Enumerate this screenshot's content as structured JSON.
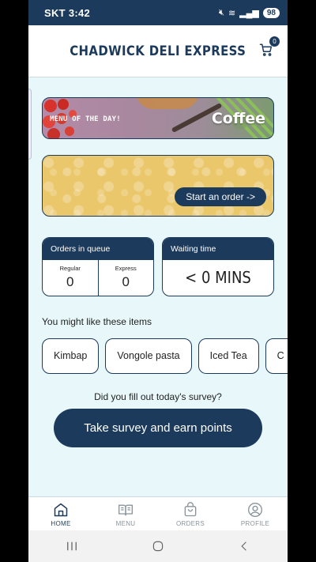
{
  "status_bar": {
    "carrier": "SKT",
    "time": "3:42",
    "battery": "98"
  },
  "header": {
    "title": "CHADWICK DELI EXPRESS",
    "cart_count": "0"
  },
  "banner_menu": {
    "label": "MENU OF THE DAY!",
    "item": "Coffee"
  },
  "banner_order": {
    "button_label": "Start an order ->"
  },
  "queue_card": {
    "title": "Orders in queue",
    "regular_label": "Regular",
    "regular_value": "0",
    "express_label": "Express",
    "express_value": "0"
  },
  "wait_card": {
    "title": "Waiting time",
    "value": "< 0 MINS"
  },
  "suggestions": {
    "title": "You might like these items",
    "items": [
      "Kimbap",
      "Vongole pasta",
      "Iced Tea",
      "C"
    ]
  },
  "survey": {
    "question": "Did you fill out today's survey?",
    "button_label": "Take survey and earn points"
  },
  "nav": {
    "items": [
      {
        "label": "HOME",
        "icon": "home-icon",
        "active": true
      },
      {
        "label": "MENU",
        "icon": "book-icon",
        "active": false
      },
      {
        "label": "ORDERS",
        "icon": "bag-icon",
        "active": false
      },
      {
        "label": "PROFILE",
        "icon": "user-icon",
        "active": false
      }
    ]
  },
  "colors": {
    "primary": "#1B3A5C",
    "background": "#E8F8FA",
    "banner_yellow": "#EAC76A"
  }
}
